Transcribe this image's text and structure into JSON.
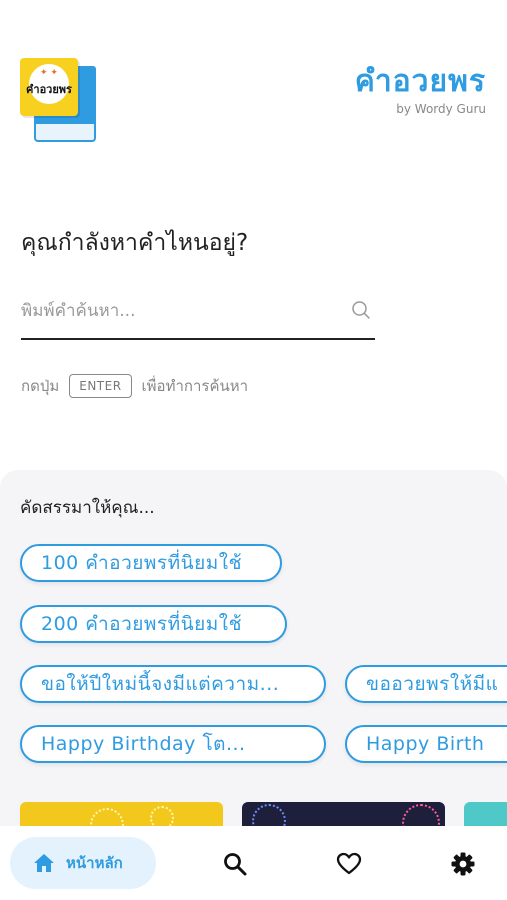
{
  "header": {
    "app_title": "คำอวยพร",
    "app_subtitle": "by Wordy Guru",
    "logo_text": "คำอวยพร"
  },
  "search": {
    "question": "คุณกำลังหาคำไหนอยู่?",
    "placeholder": "พิมพ์คำค้นหา...",
    "value": "",
    "hint_prefix": "กดปุ่ม",
    "enter_key": "ENTER",
    "hint_suffix": "เพื่อทำการค้นหา"
  },
  "recommend": {
    "title": "คัดสรรมาให้คุณ...",
    "chips": [
      "100 คำอวยพรที่นิยมใช้",
      "200 คำอวยพรที่นิยมใช้",
      "ขอให้ปีใหม่นี้จงมีแต่ความ...",
      "ขออวยพรให้มีแ",
      "Happy Birthday โต...",
      "Happy Birth"
    ]
  },
  "nav": {
    "home_label": "หน้าหลัก",
    "items": [
      "home-icon",
      "search-icon",
      "heart-icon",
      "gear-icon"
    ]
  },
  "colors": {
    "accent": "#2f9be0",
    "panel_bg": "#f5f5f7",
    "home_pill_bg": "#e3f2fc"
  }
}
